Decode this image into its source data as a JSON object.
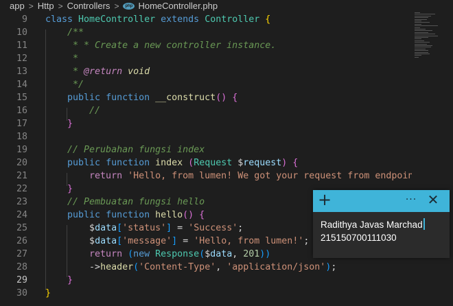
{
  "breadcrumb": {
    "items": [
      "app",
      "Http",
      "Controllers"
    ],
    "file_badge": "php",
    "file": "HomeController.php"
  },
  "editor": {
    "active_line": 29,
    "lines": [
      {
        "n": "9",
        "tokens": [
          [
            "kw2",
            "class "
          ],
          [
            "cls",
            "HomeController "
          ],
          [
            "kw2",
            "extends "
          ],
          [
            "cls",
            "Controller "
          ],
          [
            "br",
            "{"
          ]
        ]
      },
      {
        "n": "10",
        "tokens": [
          [
            "cm",
            "    /**"
          ]
        ]
      },
      {
        "n": "11",
        "tokens": [
          [
            "cm",
            "     * * Create a new controller instance."
          ]
        ]
      },
      {
        "n": "12",
        "tokens": [
          [
            "cm",
            "     *"
          ]
        ]
      },
      {
        "n": "13",
        "tokens": [
          [
            "cm",
            "     * "
          ],
          [
            "tag",
            "@return "
          ],
          [
            "typ",
            "void"
          ]
        ]
      },
      {
        "n": "14",
        "tokens": [
          [
            "cm",
            "     */"
          ]
        ]
      },
      {
        "n": "15",
        "tokens": [
          [
            "kw2",
            "    public "
          ],
          [
            "kw2",
            "function "
          ],
          [
            "fn",
            "__construct"
          ],
          [
            "br2",
            "() "
          ],
          [
            "br2",
            "{"
          ]
        ]
      },
      {
        "n": "16",
        "tokens": [
          [
            "cm",
            "        //"
          ]
        ]
      },
      {
        "n": "17",
        "tokens": [
          [
            "br2",
            "    }"
          ]
        ]
      },
      {
        "n": "18",
        "tokens": []
      },
      {
        "n": "19",
        "tokens": [
          [
            "cm",
            "    // Perubahan fungsi index"
          ]
        ]
      },
      {
        "n": "20",
        "tokens": [
          [
            "kw2",
            "    public "
          ],
          [
            "kw2",
            "function "
          ],
          [
            "fn",
            "index "
          ],
          [
            "br2",
            "("
          ],
          [
            "cls",
            "Request "
          ],
          [
            "dollar",
            "$"
          ],
          [
            "var",
            "request"
          ],
          [
            "br2",
            ") {"
          ]
        ]
      },
      {
        "n": "21",
        "tokens": [
          [
            "kw",
            "        return "
          ],
          [
            "str",
            "'Hello, from lumen! We got your request from endpoint: "
          ]
        ]
      },
      {
        "n": "22",
        "tokens": [
          [
            "br2",
            "    }"
          ]
        ]
      },
      {
        "n": "23",
        "tokens": [
          [
            "cm",
            "    // Pembuatan fungsi hello"
          ]
        ]
      },
      {
        "n": "24",
        "tokens": [
          [
            "kw2",
            "    public "
          ],
          [
            "kw2",
            "function "
          ],
          [
            "fn",
            "hello"
          ],
          [
            "br2",
            "() {"
          ]
        ]
      },
      {
        "n": "25",
        "tokens": [
          [
            "dollar",
            "        $"
          ],
          [
            "var",
            "data"
          ],
          [
            "br3",
            "["
          ],
          [
            "str",
            "'status'"
          ],
          [
            "br3",
            "]"
          ],
          [
            "dollar",
            " = "
          ],
          [
            "str",
            "'Success'"
          ],
          [
            "dollar",
            ";"
          ]
        ]
      },
      {
        "n": "26",
        "tokens": [
          [
            "dollar",
            "        $"
          ],
          [
            "var",
            "data"
          ],
          [
            "br3",
            "["
          ],
          [
            "str",
            "'message'"
          ],
          [
            "br3",
            "]"
          ],
          [
            "dollar",
            " = "
          ],
          [
            "str",
            "'Hello, from lumen!'"
          ],
          [
            "dollar",
            ";"
          ]
        ]
      },
      {
        "n": "27",
        "tokens": [
          [
            "kw",
            "        return "
          ],
          [
            "br3",
            "("
          ],
          [
            "kw2",
            "new "
          ],
          [
            "cls",
            "Response"
          ],
          [
            "br3",
            "("
          ],
          [
            "dollar",
            "$"
          ],
          [
            "var",
            "data"
          ],
          [
            "dollar",
            ", "
          ],
          [
            "num",
            "201"
          ],
          [
            "br3",
            "))"
          ]
        ]
      },
      {
        "n": "28",
        "tokens": [
          [
            "dollar",
            "        ->"
          ],
          [
            "fn",
            "header"
          ],
          [
            "br3",
            "("
          ],
          [
            "str",
            "'Content-Type'"
          ],
          [
            "dollar",
            ", "
          ],
          [
            "str",
            "'application/json'"
          ],
          [
            "br3",
            ")"
          ],
          [
            "dollar",
            ";"
          ]
        ]
      },
      {
        "n": "29",
        "tokens": [
          [
            "br2",
            "    }"
          ]
        ]
      },
      {
        "n": "30",
        "tokens": [
          [
            "br",
            "}"
          ]
        ]
      }
    ]
  },
  "sticky_note": {
    "add_icon": "plus-icon",
    "more_icon": "more-icon",
    "close_icon": "close-icon",
    "lines": [
      "Radithya Javas Marchad",
      "215150700111030"
    ],
    "header_color": "#3fb4d9"
  }
}
